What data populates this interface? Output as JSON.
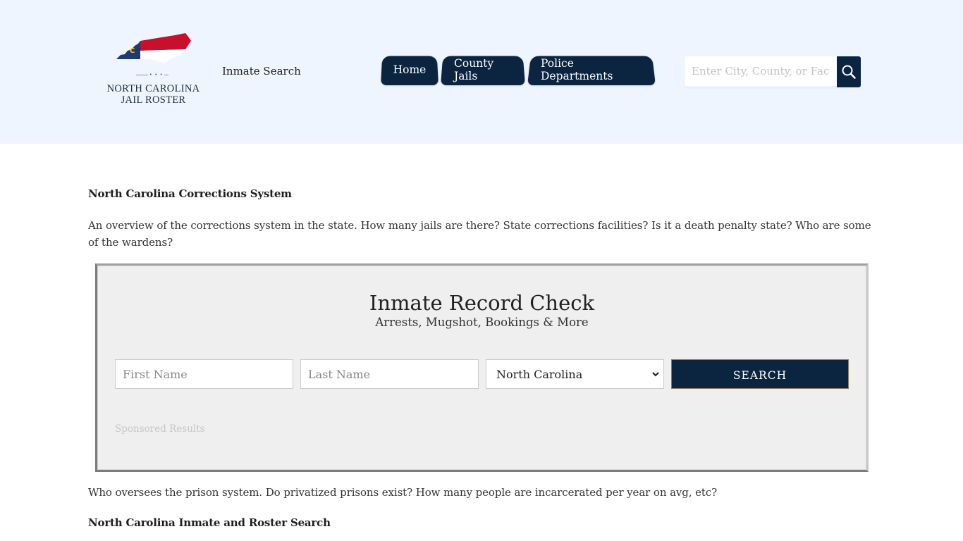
{
  "header": {
    "logo": {
      "line1": "North Carolina",
      "line2": "Jail Roster",
      "dots": "• • •",
      "colors": {
        "red": "#c8102e",
        "navy": "#1f3a70",
        "gold": "#f0c419"
      },
      "letter": "C"
    },
    "subtitle": "Inmate Search",
    "nav": [
      {
        "label": "Home"
      },
      {
        "label": "County Jails"
      },
      {
        "label": "Police Departments"
      }
    ],
    "search": {
      "placeholder": "Enter City, County, or Facility",
      "value": ""
    },
    "colors": {
      "background": "#eef5fe",
      "navy": "#0b2540"
    }
  },
  "content": {
    "section1_heading": "North Carolina Corrections System",
    "section1_para": "An overview of the corrections system in the state. How many jails are there? State corrections facilities? Is it a death penalty state? Who are some of the wardens?",
    "record_check": {
      "title": "Inmate Record Check",
      "subtitle": "Arrests, Mugshot, Bookings & More",
      "first_name_placeholder": "First Name",
      "last_name_placeholder": "Last Name",
      "state_selected": "North Carolina",
      "search_label": "SEARCH",
      "sponsored": "Sponsored Results"
    },
    "section2_para": "Who oversees the prison system. Do privatized prisons exist? How many people are incarcerated per year on avg, etc?",
    "section3_heading": "North Carolina Inmate and Roster Search"
  }
}
